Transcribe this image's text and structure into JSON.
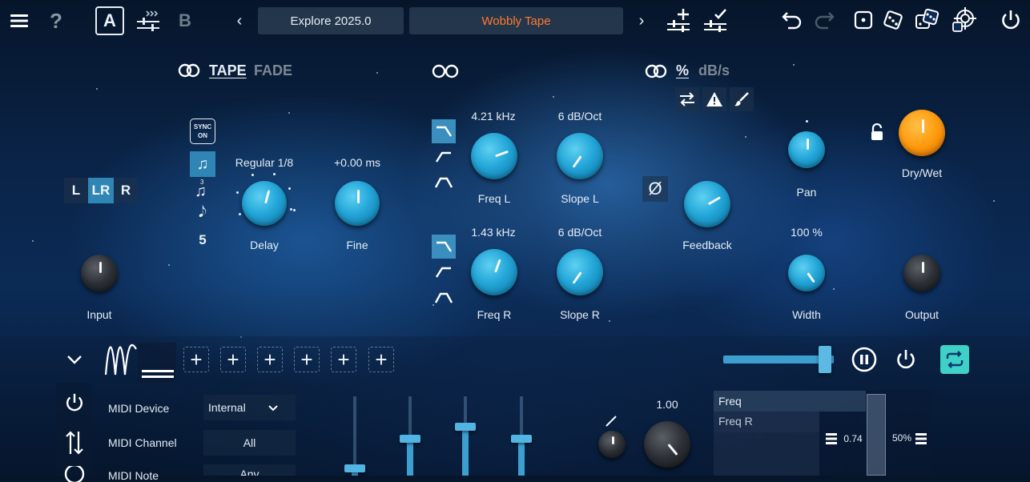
{
  "topbar": {
    "ab_a": "A",
    "ab_b": "B",
    "preset_bank": "Explore 2025.0",
    "preset_name": "Wobbly Tape",
    "preset_name_color": "#ff7a2e"
  },
  "delay_section": {
    "mode_active": "TAPE",
    "mode_inactive": "FADE",
    "sync_label_1": "SYNC",
    "sync_label_2": "ON",
    "triplet_label": "3",
    "number_value": "5",
    "channel_l": "L",
    "channel_lr": "LR",
    "channel_r": "R",
    "delay_value": "Regular 1/8",
    "delay_label": "Delay",
    "fine_value": "+0.00 ms",
    "fine_label": "Fine",
    "input_label": "Input"
  },
  "filter_section": {
    "freq_l_value": "4.21 kHz",
    "freq_l_label": "Freq L",
    "slope_l_value": "6 dB/Oct",
    "slope_l_label": "Slope L",
    "freq_r_value": "1.43 kHz",
    "freq_r_label": "Freq R",
    "slope_r_value": "6 dB/Oct",
    "slope_r_label": "Slope R"
  },
  "feedback_section": {
    "unit_percent": "%",
    "unit_dbs": "dB/s",
    "phase_symbol": "Ø",
    "feedback_label": "Feedback",
    "pan_label": "Pan",
    "width_value": "100 %",
    "width_label": "Width",
    "drywet_label": "Dry/Wet",
    "output_label": "Output"
  },
  "modulation": {
    "add_label": "+",
    "depth_value": "1.00",
    "target_1": "Freq",
    "target_2": "Freq R",
    "left_amount": "0.74",
    "right_amount": "50%"
  },
  "midi": {
    "device_label": "MIDI Device",
    "device_value": "Internal",
    "channel_label": "MIDI Channel",
    "channel_value": "All",
    "note_label": "MIDI Note",
    "note_value": "Any"
  },
  "colors": {
    "accent": "#2f86b4",
    "knob_blue": "#23a6d8",
    "drywet_orange": "#ff9a0e",
    "loop_button": "#3fd0c8"
  }
}
